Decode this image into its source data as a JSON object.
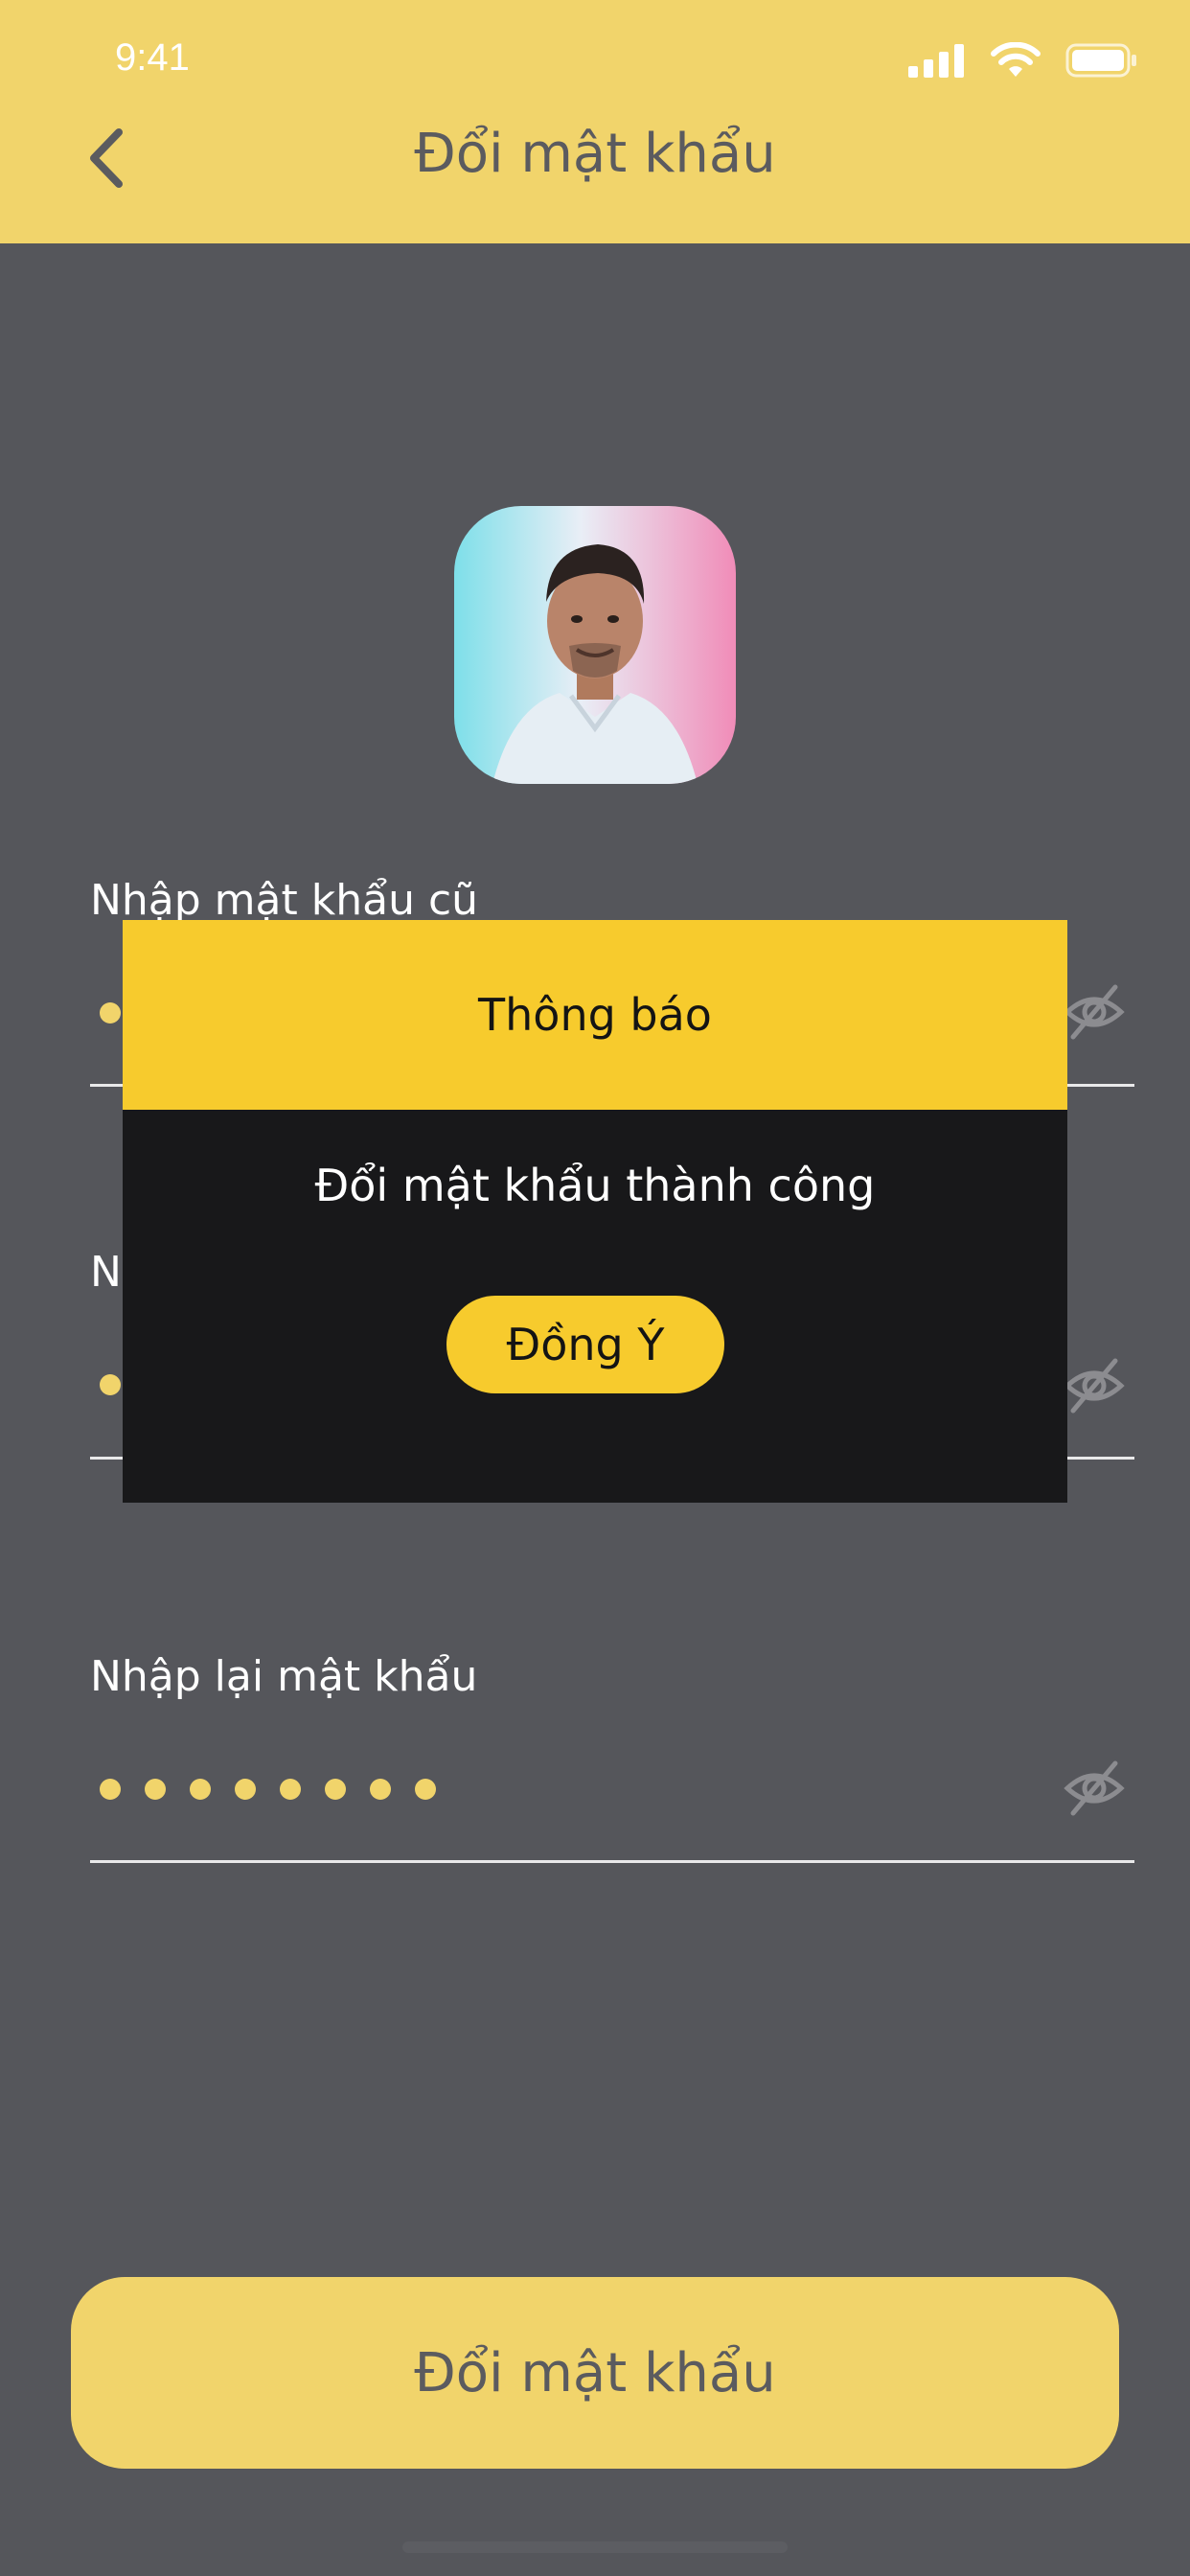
{
  "status_bar": {
    "time": "9:41"
  },
  "header": {
    "title": "Đổi mật khẩu"
  },
  "form": {
    "fields": [
      {
        "label": "Nhập mật khẩu cũ",
        "value_masked_length": 8
      },
      {
        "label": "N",
        "value_masked_length": 8
      },
      {
        "label": "Nhập lại mật khẩu",
        "value_masked_length": 8
      }
    ],
    "submit_label": "Đổi mật khẩu"
  },
  "dialog": {
    "title": "Thông báo",
    "message": "Đổi mật khẩu thành công",
    "confirm_label": "Đồng Ý"
  },
  "colors": {
    "header_bg": "#f1d46b",
    "page_bg": "#55565b",
    "dialog_accent": "#f7cb2d",
    "dialog_body": "#18181a"
  }
}
